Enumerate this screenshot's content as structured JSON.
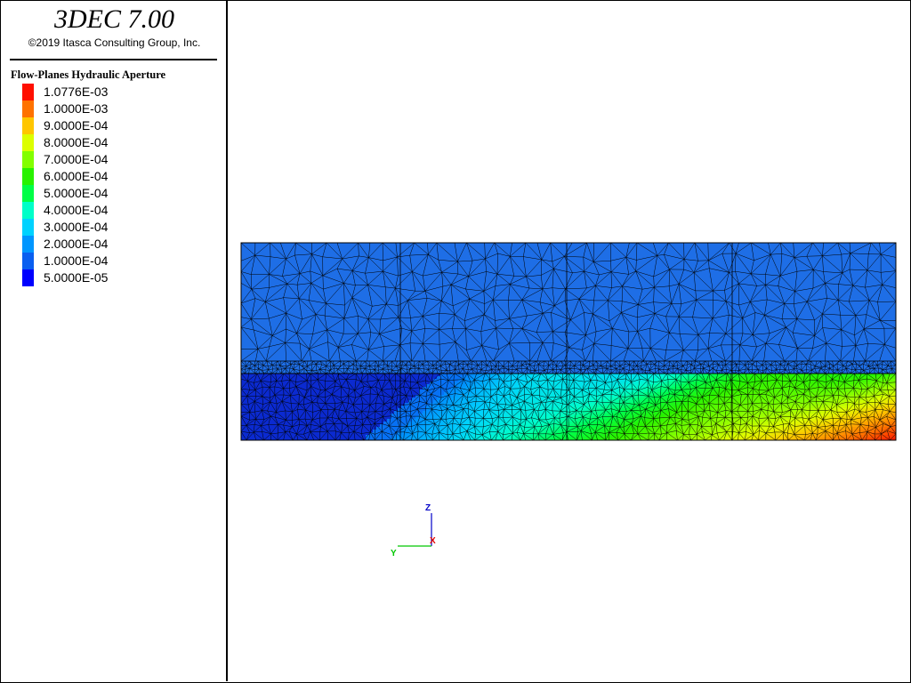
{
  "app": {
    "title": "3DEC 7.00",
    "copyright": "©2019 Itasca Consulting Group, Inc."
  },
  "legend": {
    "title": "Flow-Planes Hydraulic Aperture",
    "items": [
      {
        "label": "1.0776E-03",
        "color": "#ff0f00"
      },
      {
        "label": "1.0000E-03",
        "color": "#ff7200"
      },
      {
        "label": "9.0000E-04",
        "color": "#ffc600"
      },
      {
        "label": "8.0000E-04",
        "color": "#dcff00"
      },
      {
        "label": "7.0000E-04",
        "color": "#82ff00"
      },
      {
        "label": "6.0000E-04",
        "color": "#28f200"
      },
      {
        "label": "5.0000E-04",
        "color": "#00ff46"
      },
      {
        "label": "4.0000E-04",
        "color": "#00ffc8"
      },
      {
        "label": "3.0000E-04",
        "color": "#00d2ff"
      },
      {
        "label": "2.0000E-04",
        "color": "#0096ff"
      },
      {
        "label": "1.0000E-04",
        "color": "#0a5ff0"
      },
      {
        "label": "5.0000E-05",
        "color": "#0000ff"
      }
    ]
  },
  "axes": {
    "z_label": "Z",
    "y_label": "Y",
    "x_label": "X",
    "z_color": "#0000c8",
    "y_color": "#00c800",
    "x_color": "#e00000"
  },
  "model": {
    "upper_color": "#1e6ee6",
    "lower_base_color": "#0b2ad0",
    "mesh_color": "#000000"
  }
}
